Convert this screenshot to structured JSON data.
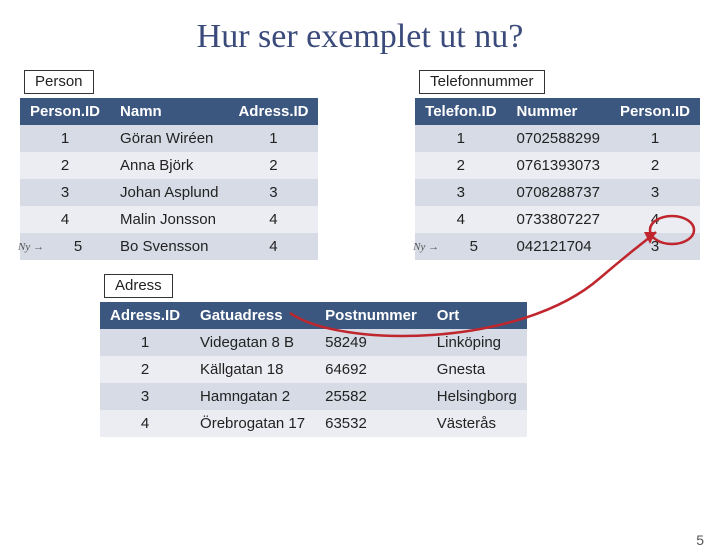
{
  "title": "Hur ser exemplet ut nu?",
  "ny_label": "Ny →",
  "page_number": "5",
  "person": {
    "label": "Person",
    "headers": {
      "id": "Person.ID",
      "namn": "Namn",
      "adressid": "Adress.ID"
    },
    "rows": [
      {
        "id": "1",
        "namn": "Göran Wiréen",
        "adressid": "1",
        "ny": false
      },
      {
        "id": "2",
        "namn": "Anna Björk",
        "adressid": "2",
        "ny": false
      },
      {
        "id": "3",
        "namn": "Johan Asplund",
        "adressid": "3",
        "ny": false
      },
      {
        "id": "4",
        "namn": "Malin Jonsson",
        "adressid": "4",
        "ny": false
      },
      {
        "id": "5",
        "namn": "Bo Svensson",
        "adressid": "4",
        "ny": true
      }
    ]
  },
  "telefon": {
    "label": "Telefonnummer",
    "headers": {
      "id": "Telefon.ID",
      "nummer": "Nummer",
      "personid": "Person.ID"
    },
    "rows": [
      {
        "id": "1",
        "nummer": "0702588299",
        "personid": "1",
        "ny": false
      },
      {
        "id": "2",
        "nummer": "0761393073",
        "personid": "2",
        "ny": false
      },
      {
        "id": "3",
        "nummer": "0708288737",
        "personid": "3",
        "ny": false
      },
      {
        "id": "4",
        "nummer": "0733807227",
        "personid": "4",
        "ny": false
      },
      {
        "id": "5",
        "nummer": "042121704",
        "personid": "3",
        "ny": true
      }
    ]
  },
  "adress": {
    "label": "Adress",
    "headers": {
      "id": "Adress.ID",
      "gata": "Gatuadress",
      "post": "Postnummer",
      "ort": "Ort"
    },
    "rows": [
      {
        "id": "1",
        "gata": "Videgatan 8 B",
        "post": "58249",
        "ort": "Linköping"
      },
      {
        "id": "2",
        "gata": "Källgatan 18",
        "post": "64692",
        "ort": "Gnesta"
      },
      {
        "id": "3",
        "gata": "Hamngatan 2",
        "post": "25582",
        "ort": "Helsingborg"
      },
      {
        "id": "4",
        "gata": "Örebrogatan 17",
        "post": "63532",
        "ort": "Västerås"
      }
    ]
  },
  "annotation": {
    "color": "#c0262e"
  }
}
